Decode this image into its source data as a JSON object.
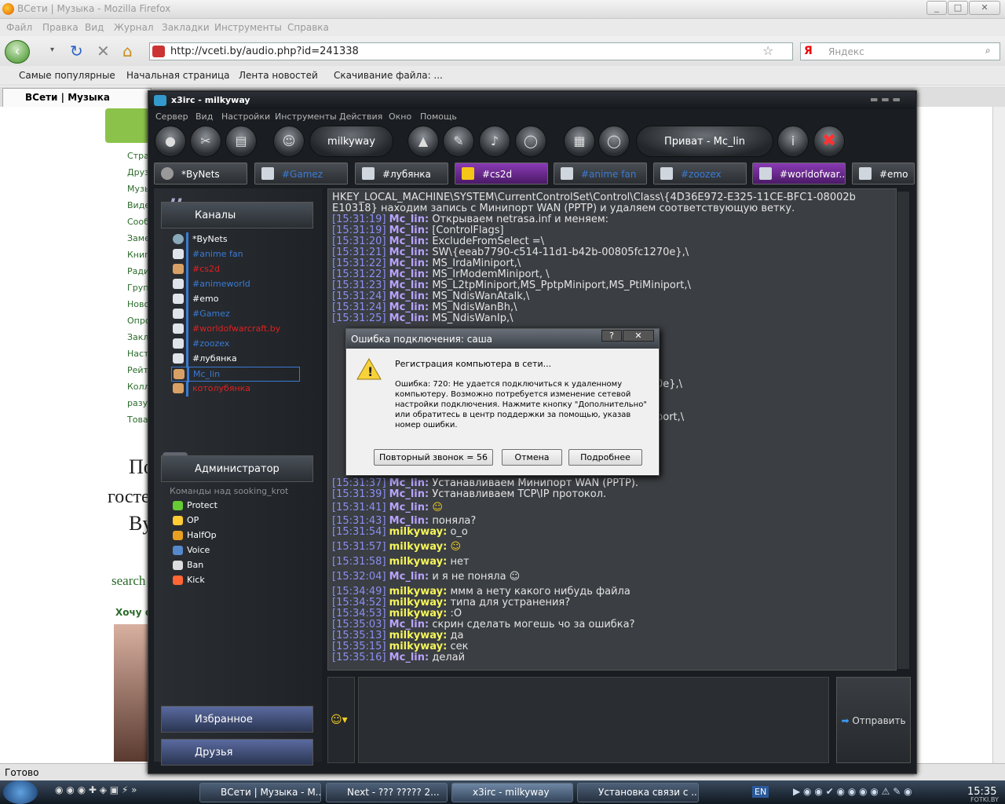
{
  "firefox": {
    "window_title": "ВСети | Музыка - Mozilla Firefox",
    "menu": [
      "Файл",
      "Правка",
      "Вид",
      "Журнал",
      "Закладки",
      "Инструменты",
      "Справка"
    ],
    "url": "http://vceti.by/audio.php?id=241338",
    "search_placeholder": "Яндекс",
    "search_engine": "Я",
    "bookmarks": [
      "Самые популярные",
      "Начальная страница",
      "Лента новостей",
      "Скачивание файла: ..."
    ],
    "tab_label": "ВСети | Музыка",
    "status": "Готово"
  },
  "page": {
    "sidebar_links": [
      "Стра",
      "Друз",
      "Музы",
      "Виде",
      "Сооб",
      "Заме",
      "Книг",
      "Ради",
      "Груп",
      "Ново",
      "Опро",
      "Закл",
      "Наст",
      "Рейт",
      "Колл",
      "разу",
      "Това"
    ],
    "text_fragments": [
      "Пои",
      "госте",
      "By",
      "search",
      "Хочу о"
    ]
  },
  "irc": {
    "window_title": "x3irc - milkyway",
    "menu": [
      "Сервер",
      "Вид",
      "Настройки",
      "Инструменты",
      "Действия",
      "Окно",
      "Помощь"
    ],
    "nick_pill": "milkyway",
    "private_pill": "Приват - Mc_lin",
    "tabs": [
      {
        "label": "*ByNets",
        "color": "#ffffff"
      },
      {
        "label": "#Gamez",
        "color": "#3a7bd5"
      },
      {
        "label": "#лубянка",
        "color": "#ffffff"
      },
      {
        "label": "#cs2d",
        "color": "#ffffff"
      },
      {
        "label": "#anime fan",
        "color": "#3a7bd5"
      },
      {
        "label": "#zoozex",
        "color": "#3a7bd5"
      },
      {
        "label": "#worldofwar...",
        "color": "#ffffff"
      },
      {
        "label": "#emo",
        "color": "#ffffff"
      }
    ],
    "channels_header": "Каналы",
    "channels": [
      {
        "label": "*ByNets",
        "color": "#ffffff"
      },
      {
        "label": "#anime fan",
        "color": "#3a7bd5"
      },
      {
        "label": "#cs2d",
        "color": "#e02020"
      },
      {
        "label": "#animeworld",
        "color": "#3a7bd5"
      },
      {
        "label": "#emo",
        "color": "#ffffff"
      },
      {
        "label": "#Gamez",
        "color": "#3a7bd5"
      },
      {
        "label": "#worldofwarcraft.by",
        "color": "#e02020"
      },
      {
        "label": "#zoozex",
        "color": "#3a7bd5"
      },
      {
        "label": "#лубянка",
        "color": "#ffffff"
      },
      {
        "label": "Mc_lin",
        "color": "#3a7bd5"
      },
      {
        "label": "котолубянка",
        "color": "#e02020"
      }
    ],
    "admin_header": "Администратор",
    "commands_caption": "Команды над sooking_krot",
    "commands": [
      "Protect",
      "OP",
      "HalfOp",
      "Voice",
      "Ban",
      "Kick"
    ],
    "favorites": "Избранное",
    "friends": "Друзья",
    "send_label": "Отправить",
    "chat": [
      {
        "ts": "",
        "nick": "",
        "text": "HKEY_LOCAL_MACHINE\\SYSTEM\\CurrentControlSet\\Control\\Class\\{4D36E972-E325-11CE-BFC1-08002b"
      },
      {
        "ts": "",
        "nick": "",
        "text": "E10318} находим запись с Минипорт WAN (PPTP) и удаляем соответствующую ветку."
      },
      {
        "ts": "[15:31:19]",
        "nick": "Mc_lin:",
        "text": "Открываем netrasa.inf и меняем:"
      },
      {
        "ts": "[15:31:19]",
        "nick": "Mc_lin:",
        "text": "[ControlFlags]"
      },
      {
        "ts": "[15:31:20]",
        "nick": "Mc_lin:",
        "text": "ExcludeFromSelect =\\"
      },
      {
        "ts": "[15:31:21]",
        "nick": "Mc_lin:",
        "text": "SW\\{eeab7790-c514-11d1-b42b-00805fc1270e},\\"
      },
      {
        "ts": "[15:31:22]",
        "nick": "Mc_lin:",
        "text": "MS_IrdaMiniport,\\"
      },
      {
        "ts": "[15:31:22]",
        "nick": "Mc_lin:",
        "text": "MS_IrModemMiniport, \\"
      },
      {
        "ts": "[15:31:23]",
        "nick": "Mc_lin:",
        "text": "MS_L2tpMiniport,MS_PptpMiniport,MS_PtiMiniport,\\"
      },
      {
        "ts": "[15:31:24]",
        "nick": "Mc_lin:",
        "text": "MS_NdisWanAtalk,\\"
      },
      {
        "ts": "[15:31:24]",
        "nick": "Mc_lin:",
        "text": "MS_NdisWanBh,\\"
      },
      {
        "ts": "[15:31:25]",
        "nick": "Mc_lin:",
        "text": "MS_NdisWanIp,\\"
      },
      {
        "ts": "[15:31:37]",
        "nick": "Mc_lin:",
        "text": "Устанавливаем Минипорт WAN (PPTP)."
      },
      {
        "ts": "[15:31:39]",
        "nick": "Mc_lin:",
        "text": "Устанавливаем TCP\\IP протокол."
      },
      {
        "ts": "[15:31:41]",
        "nick": "Mc_lin:",
        "text": "☺"
      },
      {
        "ts": "[15:31:43]",
        "nick": "Mc_lin:",
        "text": "поняла?"
      },
      {
        "ts": "[15:31:54]",
        "nick": "milkyway:",
        "text": "о_о"
      },
      {
        "ts": "[15:31:57]",
        "nick": "milkyway:",
        "text": "☺"
      },
      {
        "ts": "[15:31:58]",
        "nick": "milkyway:",
        "text": "нет"
      },
      {
        "ts": "[15:32:04]",
        "nick": "Mc_lin:",
        "text": "и я не поняла ☺"
      },
      {
        "ts": "[15:34:49]",
        "nick": "milkyway:",
        "text": "ммм а нету какого нибудь файла"
      },
      {
        "ts": "[15:34:52]",
        "nick": "milkyway:",
        "text": "типа для устранения?"
      },
      {
        "ts": "[15:34:53]",
        "nick": "milkyway:",
        "text": ":О"
      },
      {
        "ts": "[15:35:03]",
        "nick": "Mc_lin:",
        "text": "скрин сделать могешь чо за ошибка?"
      },
      {
        "ts": "[15:35:13]",
        "nick": "milkyway:",
        "text": "да"
      },
      {
        "ts": "[15:35:15]",
        "nick": "milkyway:",
        "text": "сек"
      },
      {
        "ts": "[15:35:16]",
        "nick": "Mc_lin:",
        "text": "делай"
      }
    ],
    "partial_right": [
      "0e},\\",
      "port,\\"
    ]
  },
  "dialog": {
    "title": "Ошибка подключения: саша",
    "help": "?",
    "close": "✕",
    "line1": "Регистрация компьютера в сети...",
    "message": "Ошибка: 720: Не удается подключиться к удаленному компьютеру. Возможно потребуется изменение сетевой настройки подключения. Нажмите кнопку \"Дополнительно\" или обратитесь в центр поддержки за помощью, указав номер ошибки.",
    "btn_redial": "Повторный звонок = 56",
    "btn_cancel": "Отмена",
    "btn_more": "Подробнее"
  },
  "taskbar": {
    "tasks": [
      "ВСети | Музыка - М...",
      "Next - ??? ????? 2...",
      "x3irc - milkyway",
      "Установка связи с ..."
    ],
    "lang": "EN",
    "clock": "15:35",
    "watermark": "FOTKI.BY"
  },
  "colors": {
    "mc_lin": "#b8a3ff",
    "milkyway": "#f5f55a",
    "timestamp": "#8b8ff3"
  }
}
